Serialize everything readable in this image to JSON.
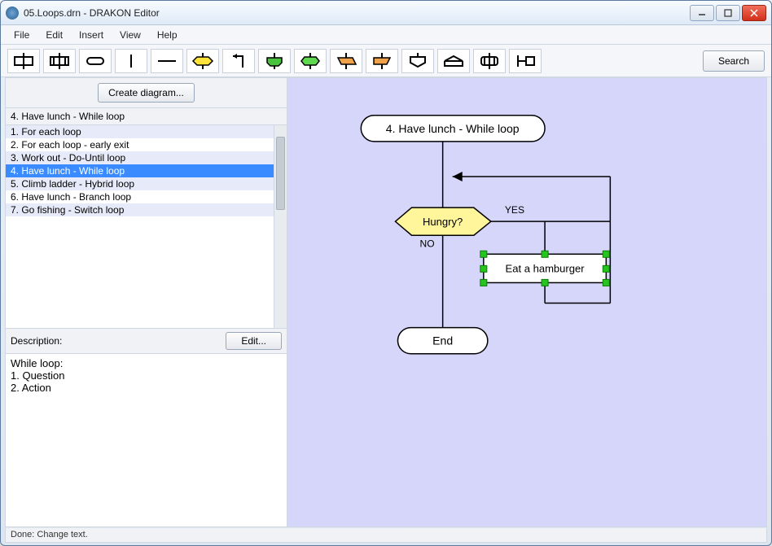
{
  "window": {
    "title": "05.Loops.drn - DRAKON Editor"
  },
  "menu": {
    "items": [
      "File",
      "Edit",
      "Insert",
      "View",
      "Help"
    ]
  },
  "toolbar": {
    "shapes": [
      "action",
      "insertion",
      "terminator",
      "vline",
      "hline",
      "question",
      "branch-arrow",
      "shelf-green",
      "case-green",
      "parallel-orange",
      "parallel-orange2",
      "input",
      "output",
      "pause",
      "timer"
    ],
    "search_label": "Search"
  },
  "sidebar": {
    "create_label": "Create diagram...",
    "current_title": "4. Have lunch - While loop",
    "items": [
      "1. For each loop",
      "2. For each loop - early exit",
      "3. Work out - Do-Until loop",
      "4. Have lunch - While loop",
      "5. Climb ladder - Hybrid loop",
      "6. Have lunch - Branch loop",
      "7. Go fishing - Switch loop"
    ],
    "selected_index": 3,
    "description_label": "Description:",
    "edit_label": "Edit...",
    "description_text": "While loop:\n1. Question\n2. Action"
  },
  "diagram": {
    "title": "4. Have lunch - While loop",
    "question": "Hungry?",
    "yes_label": "YES",
    "no_label": "NO",
    "action": "Eat a hamburger",
    "end": "End"
  },
  "status": {
    "text": "Done: Change text."
  },
  "colors": {
    "question_fill": "#fff59b",
    "selection_handle": "#27c31f",
    "canvas_bg": "#d6d6fa"
  }
}
